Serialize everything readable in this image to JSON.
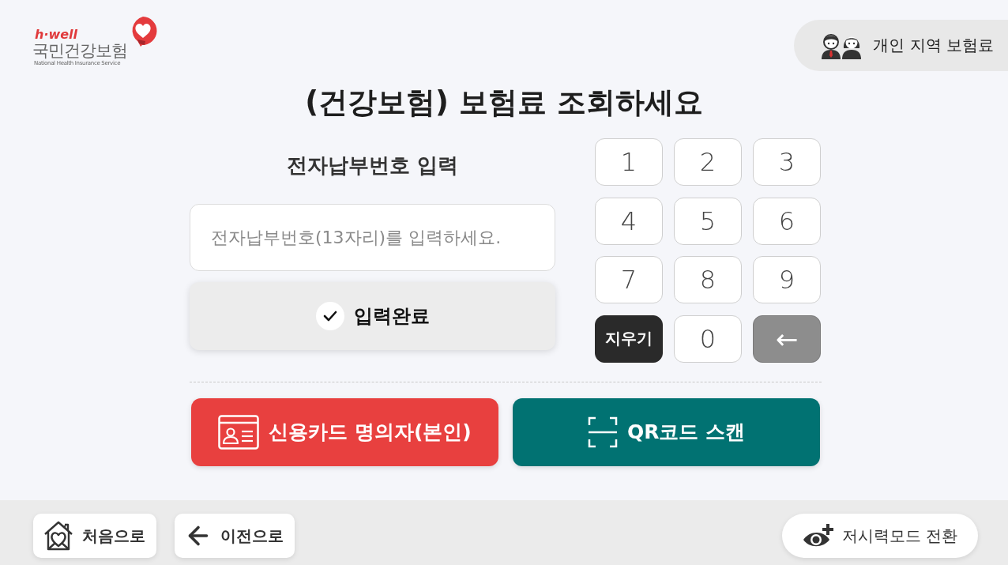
{
  "header": {
    "logo": {
      "brand": "h·well",
      "name": "국민건강보험",
      "subtitle": "National Health Insurance Service"
    },
    "mode_button": {
      "label": "개인 지역 보험료"
    }
  },
  "title": "(건강보험) 보험료 조회하세요",
  "entry": {
    "heading": "전자납부번호 입력",
    "field": {
      "placeholder": "전자납부번호(13자리)를 입력하세요."
    },
    "submit": {
      "label": "입력완료"
    }
  },
  "keypad": {
    "keys": [
      {
        "label": "1",
        "kind": "digit"
      },
      {
        "label": "2",
        "kind": "digit"
      },
      {
        "label": "3",
        "kind": "digit"
      },
      {
        "label": "4",
        "kind": "digit"
      },
      {
        "label": "5",
        "kind": "digit"
      },
      {
        "label": "6",
        "kind": "digit"
      },
      {
        "label": "7",
        "kind": "digit"
      },
      {
        "label": "8",
        "kind": "digit"
      },
      {
        "label": "9",
        "kind": "digit"
      },
      {
        "label": "지우기",
        "kind": "clear"
      },
      {
        "label": "0",
        "kind": "digit"
      },
      {
        "label": "←",
        "kind": "backspace"
      }
    ]
  },
  "payment_buttons": [
    {
      "label": "신용카드 명의자(본인)",
      "kind": "card"
    },
    {
      "label": "QR코드 스캔",
      "kind": "qr"
    }
  ],
  "footer": {
    "nav": [
      {
        "label": "처음으로",
        "kind": "home"
      },
      {
        "label": "이전으로",
        "kind": "back"
      }
    ],
    "accessibility": {
      "label": "저시력모드 전환"
    }
  }
}
